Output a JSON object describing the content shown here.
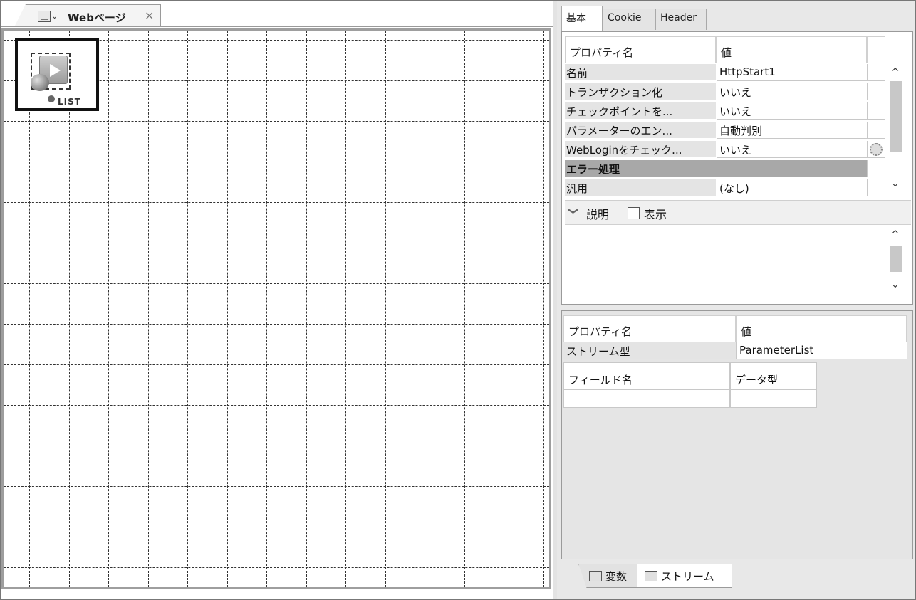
{
  "editor": {
    "tab_label": "Webページ",
    "close_glyph": "×",
    "arrow_glyph": "⌄",
    "node_label": "LIST"
  },
  "properties": {
    "tabs": [
      "基本",
      "Cookie",
      "Header"
    ],
    "header_name": "プロパティ名",
    "header_value": "値",
    "rows": [
      {
        "name": "名前",
        "value": "HttpStart1"
      },
      {
        "name": "トランザクション化",
        "value": "いいえ"
      },
      {
        "name": "チェックポイントを...",
        "value": "いいえ"
      },
      {
        "name": "パラメーターのエン...",
        "value": "自動判別"
      },
      {
        "name": "WebLoginをチェック...",
        "value": "いいえ"
      },
      {
        "name": "エラー処理",
        "value": ""
      },
      {
        "name": "汎用",
        "value": "(なし)"
      }
    ],
    "description_label": "説明",
    "show_label": "表示",
    "chevron_glyph": "❯"
  },
  "stream": {
    "header_name": "プロパティ名",
    "header_value": "値",
    "type_name": "ストリーム型",
    "type_value": "ParameterList",
    "field_name_header": "フィールド名",
    "data_type_header": "データ型"
  },
  "bottom_tabs": [
    "変数",
    "ストリーム"
  ],
  "scroll": {
    "up": "^",
    "down": "⌄"
  }
}
